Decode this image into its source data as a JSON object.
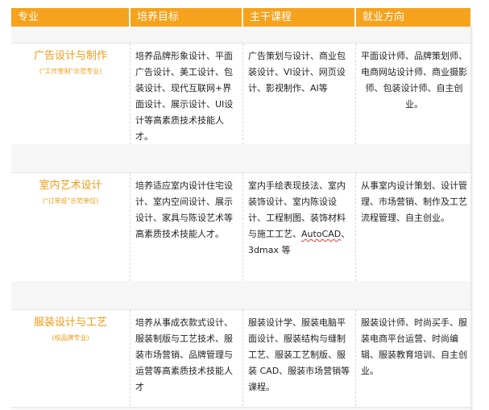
{
  "header": {
    "col_major": "专业",
    "col_goal": "培养目标",
    "col_courses": "主干课程",
    "col_career": "就业方向"
  },
  "rows": [
    {
      "name": "广告设计与制作",
      "note": "(\"工作室制\"示范专业)",
      "goal": "培养品牌形象设计、平面广告设计、美工设计、包装设计、现代互联网+界面设计、展示设计、UI设计等高素质技术技能人才。",
      "courses": "广告策划与设计、商业包装设计、VI设计、网页设计、影视制作、AI等",
      "career": "平面设计师、品牌策划师、电商网站设计师、商业摄影师、包装设计师、自主创业。"
    },
    {
      "name": "室内艺术设计",
      "note": "(\"订单班\"示范单位)",
      "goal": "培养适应室内设计住宅设计、室内空间设计、展示设计、家具与陈设艺术等高素质技术技能人才。",
      "courses_pre": "室内手绘表现技法、室内装饰设计、室内陈设设计、工程制图、装饰材料与施工工艺、",
      "courses_mark": "AutoCAD",
      "courses_post": "、3dmax 等",
      "career": "从事室内设计策划、设计管理、市场营销、制作及工艺流程管理、自主创业。"
    },
    {
      "name": "服装设计与工艺",
      "note": "(校品牌专业)",
      "goal": "培养从事成衣款式设计、服装制版与工艺技术、服装市场营销、品牌管理与运营等高素质技术技能人才",
      "courses": "服装设计学、服装电脑平面设计、服装结构与缝制工艺、服装工艺制版、服装 CAD、服装市场营销等课程。",
      "career": "服装设计师、时尚买手、服装电商平台运营、时尚编辑、服装教育培训、自主创业。"
    }
  ]
}
